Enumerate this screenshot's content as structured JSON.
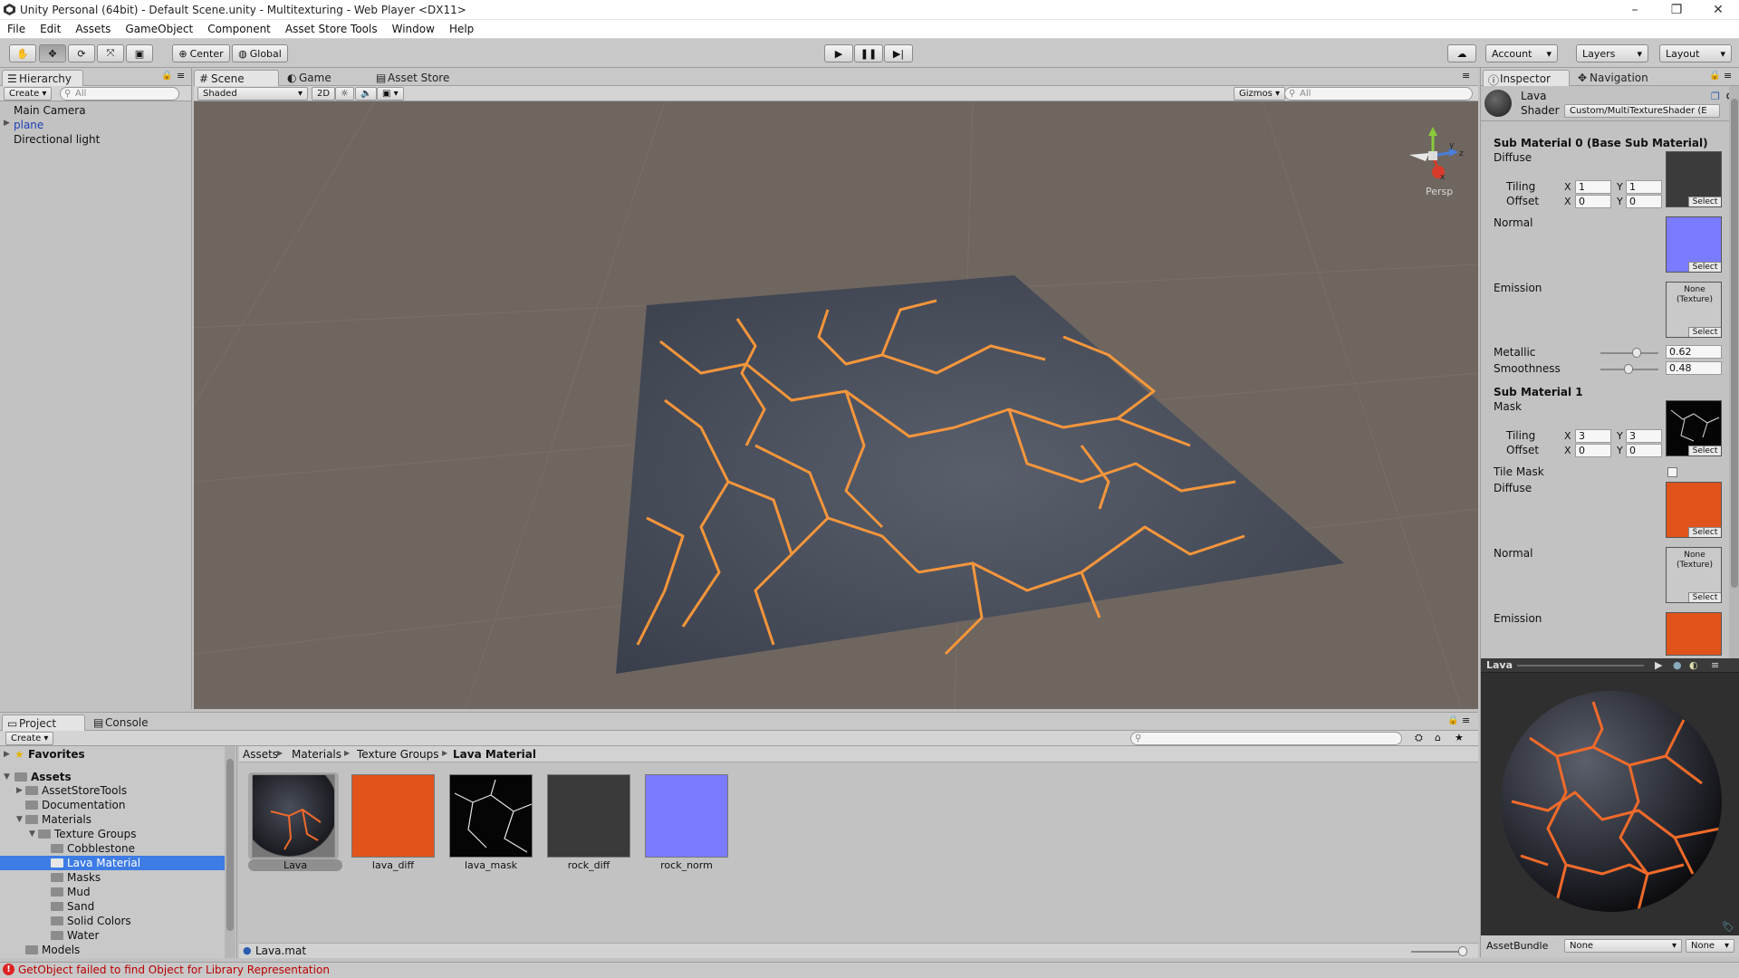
{
  "window": {
    "title": "Unity Personal (64bit) - Default Scene.unity - Multitexturing - Web Player <DX11>",
    "controls": [
      "–",
      "❐",
      "✕"
    ]
  },
  "menu": [
    "File",
    "Edit",
    "Assets",
    "GameObject",
    "Component",
    "Asset Store Tools",
    "Window",
    "Help"
  ],
  "toolbar": {
    "center_label": "Center",
    "global_label": "Global",
    "account_label": "Account",
    "layers_label": "Layers",
    "layout_label": "Layout"
  },
  "hierarchy": {
    "tab": "Hierarchy",
    "create": "Create",
    "search_placeholder": "All",
    "items": [
      "Main Camera",
      "plane",
      "Directional light"
    ]
  },
  "scene": {
    "tabs": [
      "Scene",
      "Game",
      "Asset Store"
    ],
    "shading": "Shaded",
    "mode_2d": "2D",
    "gizmos": "Gizmos",
    "search_placeholder": "All",
    "persp": "Persp",
    "axis": {
      "y": "y",
      "z": "z",
      "x": "x"
    }
  },
  "inspector": {
    "tabs": [
      "Inspector",
      "Navigation"
    ],
    "name": "Lava",
    "shader_label": "Shader",
    "shader_value": "Custom/MultiTextureShader (E",
    "sub0_title": "Sub Material 0 (Base Sub Material)",
    "diffuse": "Diffuse",
    "tiling": "Tiling",
    "offset": "Offset",
    "normal": "Normal",
    "emission": "Emission",
    "none_texture": "None (Texture)",
    "select": "Select",
    "x": "X",
    "y": "Y",
    "sub0_tiling_x": "1",
    "sub0_tiling_y": "1",
    "sub0_offset_x": "0",
    "sub0_offset_y": "0",
    "metallic_label": "Metallic",
    "metallic_value": "0.62",
    "metallic": 0.62,
    "smoothness_label": "Smoothness",
    "smoothness_value": "0.48",
    "smoothness": 0.48,
    "sub1_title": "Sub Material 1",
    "mask": "Mask",
    "sub1_tiling_x": "3",
    "sub1_tiling_y": "3",
    "sub1_offset_x": "0",
    "sub1_offset_y": "0",
    "tile_mask": "Tile Mask"
  },
  "preview": {
    "title": "Lava",
    "assetbundle_label": "AssetBundle",
    "bundle_value": "None",
    "variant_value": "None"
  },
  "project": {
    "tabs": [
      "Project",
      "Console"
    ],
    "create": "Create",
    "favorites": "Favorites",
    "tree": {
      "assets": "Assets",
      "asset_store_tools": "AssetStoreTools",
      "documentation": "Documentation",
      "materials": "Materials",
      "texture_groups": "Texture Groups",
      "cobblestone": "Cobblestone",
      "lava_material": "Lava Material",
      "masks": "Masks",
      "mud": "Mud",
      "sand": "Sand",
      "solid_colors": "Solid Colors",
      "water": "Water",
      "models": "Models"
    },
    "breadcrumb": [
      "Assets",
      "Materials",
      "Texture Groups",
      "Lava Material"
    ],
    "assets": [
      "Lava",
      "lava_diff",
      "lava_mask",
      "rock_diff",
      "rock_norm"
    ],
    "selected_file": "Lava.mat"
  },
  "status": {
    "message": "GetObject failed to find Object for Library Representation"
  },
  "colors": {
    "selection": "#3d7be5",
    "lava": "#ff9a3a",
    "normal_map": "#7b7bff",
    "scene_bg": "#6f665f"
  }
}
